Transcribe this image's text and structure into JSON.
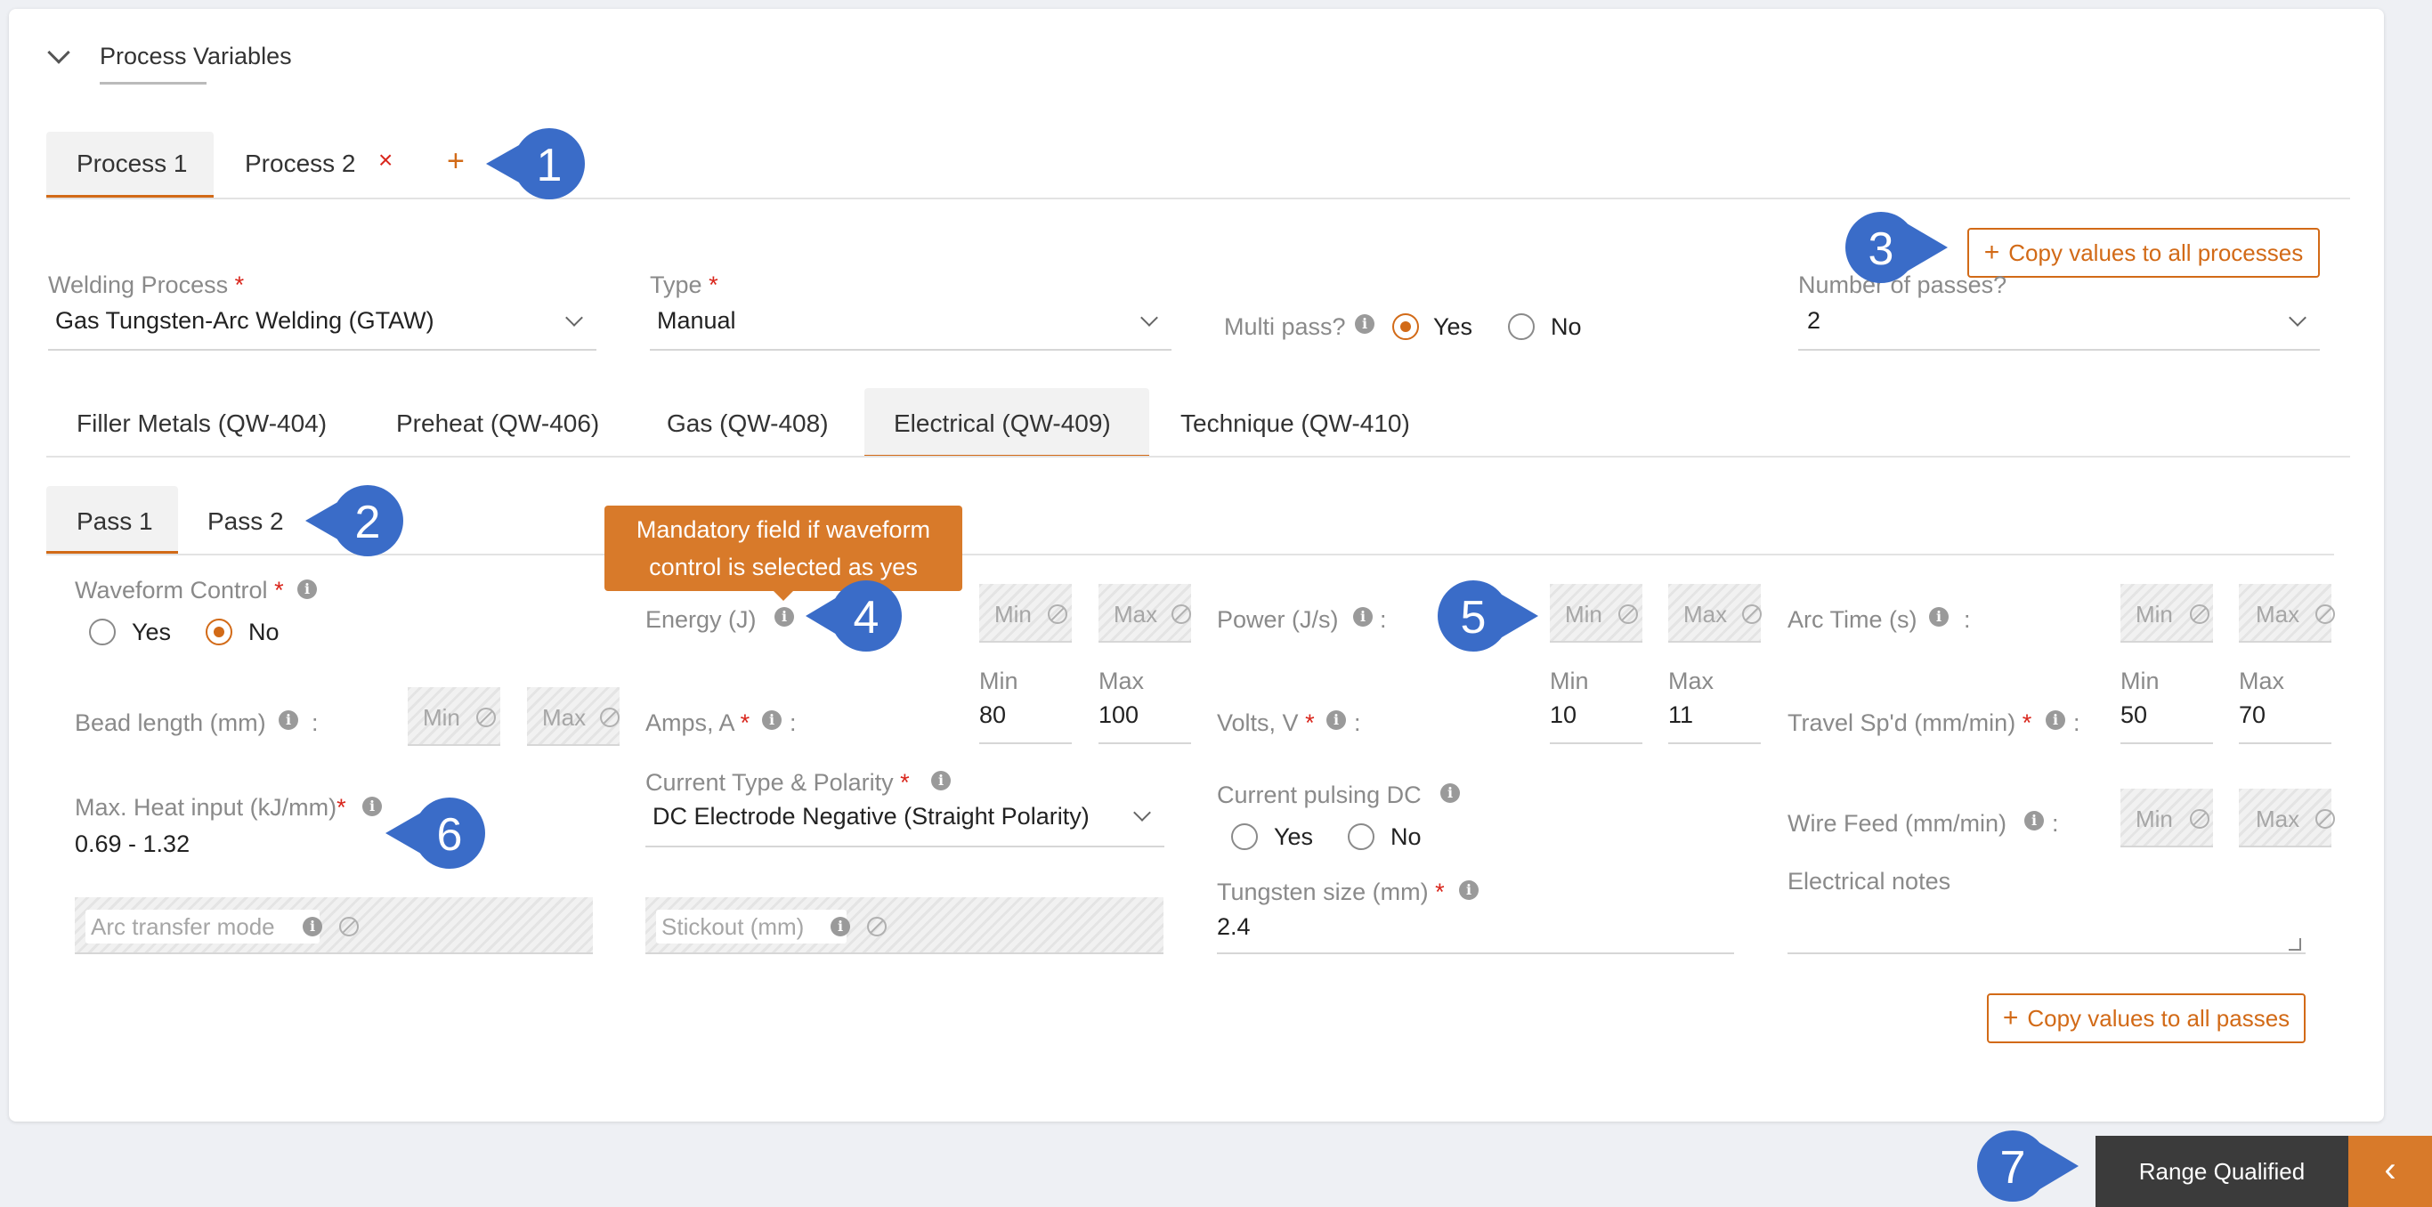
{
  "section": {
    "title": "Process Variables"
  },
  "process_tabs": {
    "items": [
      {
        "label": "Process 1"
      },
      {
        "label": "Process 2",
        "close": "×"
      }
    ],
    "add": "+"
  },
  "copy_processes": {
    "icon": "+",
    "label": "Copy values to all processes"
  },
  "fields": {
    "welding_process": {
      "label": "Welding Process",
      "required": "*",
      "value": "Gas Tungsten-Arc Welding (GTAW)"
    },
    "type": {
      "label": "Type",
      "required": "*",
      "value": "Manual"
    },
    "multi_pass": {
      "label": "Multi pass?",
      "options": [
        "Yes",
        "No"
      ],
      "selected": "Yes"
    },
    "number_of_passes": {
      "label": "Number of passes?",
      "value": "2"
    }
  },
  "qw_tabs": [
    "Filler Metals (QW-404)",
    "Preheat (QW-406)",
    "Gas (QW-408)",
    "Electrical (QW-409)",
    "Technique (QW-410)"
  ],
  "qw_active": "Electrical (QW-409)",
  "pass_tabs": [
    "Pass 1",
    "Pass 2"
  ],
  "tooltip": {
    "line1": "Mandatory field if waveform",
    "line2": "control is selected as yes"
  },
  "min_label": "Min",
  "max_label": "Max",
  "colon": ":",
  "electrical": {
    "waveform_control": {
      "label": "Waveform Control",
      "required": "*",
      "options": [
        "Yes",
        "No"
      ],
      "selected": "No"
    },
    "energy": {
      "label": "Energy (J)"
    },
    "power": {
      "label": "Power (J/s)"
    },
    "arc_time": {
      "label": "Arc Time (s)"
    },
    "bead_length": {
      "label": "Bead length (mm)"
    },
    "amps": {
      "label": "Amps, A",
      "required": "*",
      "min": "80",
      "max": "100"
    },
    "volts": {
      "label": "Volts, V",
      "required": "*",
      "min": "10",
      "max": "11"
    },
    "travel_speed": {
      "label": "Travel Sp'd (mm/min)",
      "required": "*",
      "min": "50",
      "max": "70"
    },
    "max_heat_input": {
      "label": "Max. Heat input (kJ/mm)",
      "required": "*",
      "value": "0.69 - 1.32"
    },
    "current_type": {
      "label": "Current Type & Polarity",
      "required": "*",
      "value": "DC Electrode Negative (Straight Polarity)"
    },
    "current_pulsing": {
      "label": "Current pulsing DC",
      "options": [
        "Yes",
        "No"
      ]
    },
    "wire_feed": {
      "label": "Wire Feed (mm/min)"
    },
    "arc_transfer_mode": {
      "label": "Arc transfer mode"
    },
    "stickout": {
      "label": "Stickout (mm)"
    },
    "tungsten_size": {
      "label": "Tungsten size (mm)",
      "required": "*",
      "value": "2.4"
    },
    "electrical_notes": {
      "label": "Electrical notes"
    }
  },
  "copy_passes": {
    "icon": "+",
    "label": "Copy values to all passes"
  },
  "range_qualified": {
    "label": "Range Qualified",
    "arrow": "‹"
  },
  "markers": [
    "1",
    "2",
    "3",
    "4",
    "5",
    "6",
    "7"
  ],
  "colors": {
    "accent": "#d26a17",
    "marker": "#3a6cc8",
    "required": "#d9261c",
    "bar": "#3b3b3b"
  }
}
